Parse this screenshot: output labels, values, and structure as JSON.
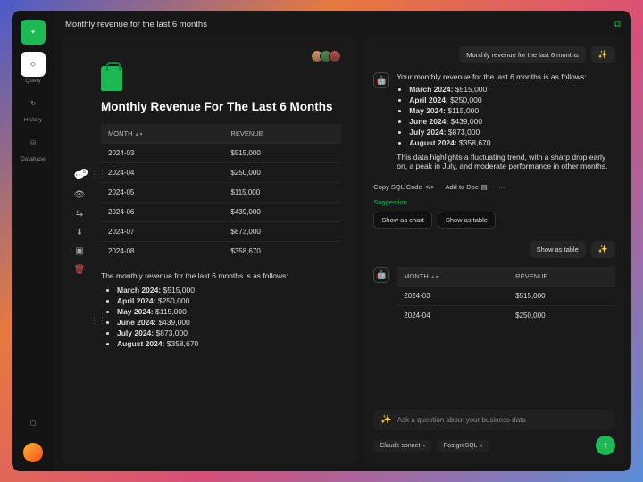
{
  "title": "Monthly revenue for the last 6 months",
  "sidebar": {
    "items": [
      {
        "icon": "✦",
        "tone": "green"
      },
      {
        "icon": "◇",
        "tone": "white",
        "label": "Query"
      },
      {
        "icon": "↻",
        "tone": "plain",
        "label": "History"
      },
      {
        "icon": "⛁",
        "tone": "plain",
        "label": "Database"
      }
    ],
    "bottom_icon": "▢"
  },
  "doc": {
    "heading": "Monthly Revenue For The Last 6 Months",
    "table": {
      "columns": [
        "MONTH",
        "REVENUE"
      ],
      "rows": [
        {
          "month": "2024-03",
          "revenue": "$515,000"
        },
        {
          "month": "2024-04",
          "revenue": "$250,000"
        },
        {
          "month": "2024-05",
          "revenue": "$115,000"
        },
        {
          "month": "2024-06",
          "revenue": "$439,000"
        },
        {
          "month": "2024-07",
          "revenue": "$873,000"
        },
        {
          "month": "2024-08",
          "revenue": "$358,670"
        }
      ]
    },
    "summary_intro": "The monthly revenue for the last 6 months is as follows:",
    "bullets": [
      {
        "label": "March 2024:",
        "value": "$515,000"
      },
      {
        "label": "April 2024:",
        "value": "$250,000"
      },
      {
        "label": "May 2024:",
        "value": "$115,000"
      },
      {
        "label": "June 2024:",
        "value": "$439,000"
      },
      {
        "label": "July 2024:",
        "value": "$873,000"
      },
      {
        "label": "August 2024:",
        "value": "$358,670"
      }
    ],
    "tool_badge": "5"
  },
  "chat": {
    "user_chip": "Monthly revenue for the last 6 months",
    "assistant_intro": "Your monthly revenue for the last 6 months is as follows:",
    "assistant_bullets": [
      {
        "label": "March 2024:",
        "value": "$515,000"
      },
      {
        "label": "April 2024:",
        "value": "$250,000"
      },
      {
        "label": "May 2024:",
        "value": "$115,000"
      },
      {
        "label": "June 2024:",
        "value": "$439,000"
      },
      {
        "label": "July 2024:",
        "value": "$873,000"
      },
      {
        "label": "August 2024:",
        "value": "$358,670"
      }
    ],
    "assistant_trend": "This data highlights a fluctuating trend, with a sharp drop early on, a peak in July, and moderate performance in other months.",
    "actions": {
      "copy_sql": "Copy SQL Code",
      "add_doc": "Add to Doc"
    },
    "suggestion_label": "Suggestion",
    "suggestions": [
      "Show as chart",
      "Show as table"
    ],
    "user_chip2": "Show as table",
    "table2": {
      "columns": [
        "MONTH",
        "REVENUE"
      ],
      "rows": [
        {
          "month": "2024-03",
          "revenue": "$515,000"
        },
        {
          "month": "2024-04",
          "revenue": "$250,000"
        }
      ]
    },
    "input_placeholder": "Ask a question about your business data",
    "model": "Claude sonnet",
    "db": "PostgreSQL"
  },
  "chart_data": {
    "type": "table",
    "title": "Monthly Revenue For The Last 6 Months",
    "categories": [
      "2024-03",
      "2024-04",
      "2024-05",
      "2024-06",
      "2024-07",
      "2024-08"
    ],
    "values": [
      515000,
      250000,
      115000,
      439000,
      873000,
      358670
    ],
    "xlabel": "Month",
    "ylabel": "Revenue (USD)"
  }
}
